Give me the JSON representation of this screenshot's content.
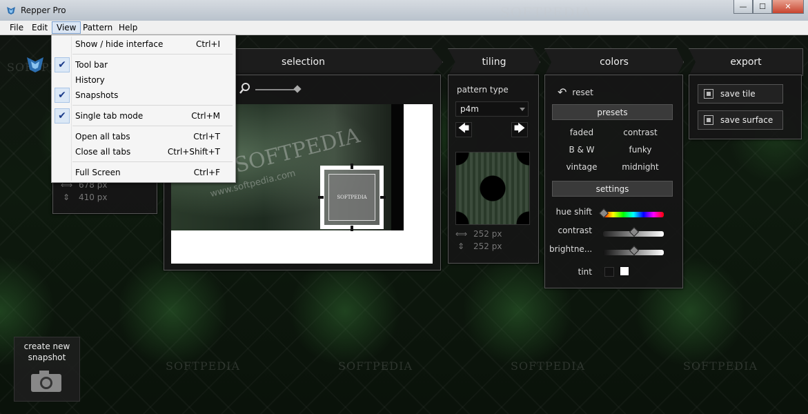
{
  "window": {
    "title": "Repper Pro",
    "controls": {
      "minimize": "—",
      "maximize": "☐",
      "close": "✕"
    }
  },
  "menubar": {
    "items": [
      "File",
      "Edit",
      "View",
      "Pattern",
      "Help"
    ],
    "active": "View"
  },
  "view_menu": {
    "items": [
      {
        "label": "Show / hide interface",
        "shortcut": "Ctrl+I",
        "checked": false
      },
      {
        "label": "Tool bar",
        "shortcut": "",
        "checked": true
      },
      {
        "label": "History",
        "shortcut": "",
        "checked": false
      },
      {
        "label": "Snapshots",
        "shortcut": "",
        "checked": true
      },
      {
        "label": "Single tab mode",
        "shortcut": "Ctrl+M",
        "checked": true
      },
      {
        "label": "Open all tabs",
        "shortcut": "Ctrl+T",
        "checked": false
      },
      {
        "label": "Close all tabs",
        "shortcut": "Ctrl+Shift+T",
        "checked": false
      },
      {
        "label": "Full Screen",
        "shortcut": "Ctrl+F",
        "checked": false
      }
    ]
  },
  "left_info": {
    "width": "678 px",
    "height": "410 px"
  },
  "selection": {
    "title": "selection"
  },
  "tiling": {
    "title": "tiling",
    "pattern_type_label": "pattern type",
    "pattern_type_value": "p4m",
    "tile_width": "252 px",
    "tile_height": "252 px"
  },
  "colors": {
    "title": "colors",
    "reset_label": "reset",
    "presets_label": "presets",
    "presets": [
      "faded",
      "contrast",
      "B & W",
      "funky",
      "vintage",
      "midnight"
    ],
    "settings_label": "settings",
    "hue_shift_label": "hue shift",
    "contrast_label": "contrast",
    "brightness_label": "brightne...",
    "tint_label": "tint",
    "hue_shift_level": 0.0,
    "contrast_level": 0.5,
    "brightness_level": 0.5
  },
  "export": {
    "title": "export",
    "save_tile_label": "save tile",
    "save_surface_label": "save surface"
  },
  "snapshot": {
    "label_line1": "create new",
    "label_line2": "snapshot"
  },
  "watermark": {
    "brand": "SOFTPEDIA",
    "url": "www.softpedia.com"
  }
}
